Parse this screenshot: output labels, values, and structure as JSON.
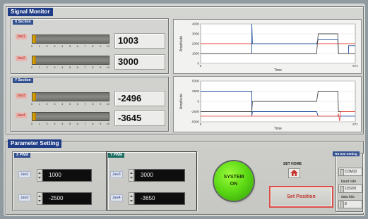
{
  "signal_monitor": {
    "title": "Signal Monitor",
    "x_section": {
      "title": "X Section",
      "jaws": [
        {
          "label": "Jaw1",
          "value": "1003",
          "level": 0.0
        },
        {
          "label": "Jaw2",
          "value": "3000",
          "level": 0.0
        }
      ]
    },
    "y_section": {
      "title": "Y Section",
      "jaws": [
        {
          "label": "Jaw3",
          "value": "-2496",
          "level": 0.0
        },
        {
          "label": "Jaw4",
          "value": "-3645",
          "level": 0.0
        }
      ]
    },
    "tick_labels": [
      "0",
      "1",
      "2",
      "3",
      "4",
      "5",
      "6",
      "7",
      "8",
      "9",
      "10"
    ]
  },
  "chart_data": [
    {
      "type": "line",
      "xlabel": "Time",
      "ylabel": "Amplitude",
      "x_tick_labels": [
        "0",
        "671"
      ],
      "y_tick_labels": [
        "4000",
        "3000",
        "2000",
        "1000",
        "0"
      ],
      "xlim": [
        0,
        671
      ],
      "ylim": [
        0,
        4000
      ],
      "grid": true,
      "series": [
        {
          "color": "#e74c3c",
          "points": [
            [
              0,
              2000
            ],
            [
              670,
              2000
            ]
          ]
        },
        {
          "color": "#1f4e9b",
          "points": [
            [
              0,
              1000
            ],
            [
              222,
              1000
            ],
            [
              222,
              4000
            ],
            [
              225,
              2000
            ],
            [
              503,
              2000
            ],
            [
              510,
              2400
            ],
            [
              595,
              2400
            ],
            [
              598,
              1000
            ],
            [
              642,
              1000
            ],
            [
              642,
              1800
            ],
            [
              670,
              1800
            ]
          ]
        },
        {
          "color": "#4a4a4a",
          "points": [
            [
              0,
              1000
            ],
            [
              222,
              1000
            ],
            [
              222,
              1000
            ],
            [
              503,
              1000
            ],
            [
              510,
              3000
            ],
            [
              595,
              3000
            ],
            [
              598,
              1000
            ],
            [
              670,
              1000
            ]
          ]
        }
      ]
    },
    {
      "type": "line",
      "xlabel": "Time",
      "ylabel": "Amplitude",
      "x_tick_labels": [
        "0",
        "671"
      ],
      "y_tick_labels": [
        "5000",
        "2500",
        "0",
        "-2500",
        "-5000"
      ],
      "xlim": [
        0,
        671
      ],
      "ylim": [
        -5000,
        5000
      ],
      "grid": true,
      "series": [
        {
          "color": "#1f4e9b",
          "points": [
            [
              0,
              2500
            ],
            [
              222,
              2500
            ],
            [
              222,
              -3600
            ],
            [
              225,
              -2500
            ],
            [
              503,
              -2500
            ],
            [
              510,
              -3600
            ],
            [
              595,
              -3600
            ],
            [
              598,
              -3600
            ],
            [
              670,
              -3600
            ]
          ]
        },
        {
          "color": "#4a4a4a",
          "points": [
            [
              0,
              -2500
            ],
            [
              222,
              -2500
            ],
            [
              225,
              0
            ],
            [
              503,
              0
            ],
            [
              510,
              2500
            ],
            [
              595,
              2500
            ],
            [
              598,
              -2500
            ],
            [
              670,
              -2500
            ]
          ]
        },
        {
          "color": "#e74c3c",
          "points": [
            [
              0,
              -3600
            ],
            [
              222,
              -3600
            ],
            [
              225,
              -3600
            ],
            [
              503,
              -3600
            ],
            [
              510,
              -3600
            ],
            [
              595,
              -3600
            ],
            [
              598,
              -3000
            ],
            [
              603,
              -4800
            ],
            [
              608,
              -2500
            ],
            [
              670,
              -2500
            ]
          ]
        }
      ]
    }
  ],
  "parameter_setting": {
    "title": "Parameter Setting",
    "x_pwm": {
      "title": "X PWM",
      "jaws": [
        {
          "label": "Jaw1",
          "value": "1000"
        },
        {
          "label": "Jaw2",
          "value": "-2500"
        }
      ]
    },
    "y_pwm": {
      "title": "Y PWM",
      "jaws": [
        {
          "label": "Jaw3",
          "value": "3000"
        },
        {
          "label": "Jaw4",
          "value": "-3650"
        }
      ]
    },
    "system_on": {
      "line1": "SYSTEM",
      "line2": "ON"
    },
    "set_home": {
      "label": "SET HOME"
    },
    "set_position": {
      "label": "Set Position"
    },
    "rs232": {
      "title": "RS-232 Setting",
      "port_value": "COM10",
      "baud_label": "baud rate",
      "baud_value": "115200",
      "data_bits_label": "data bits",
      "data_bits_value": "8"
    }
  }
}
